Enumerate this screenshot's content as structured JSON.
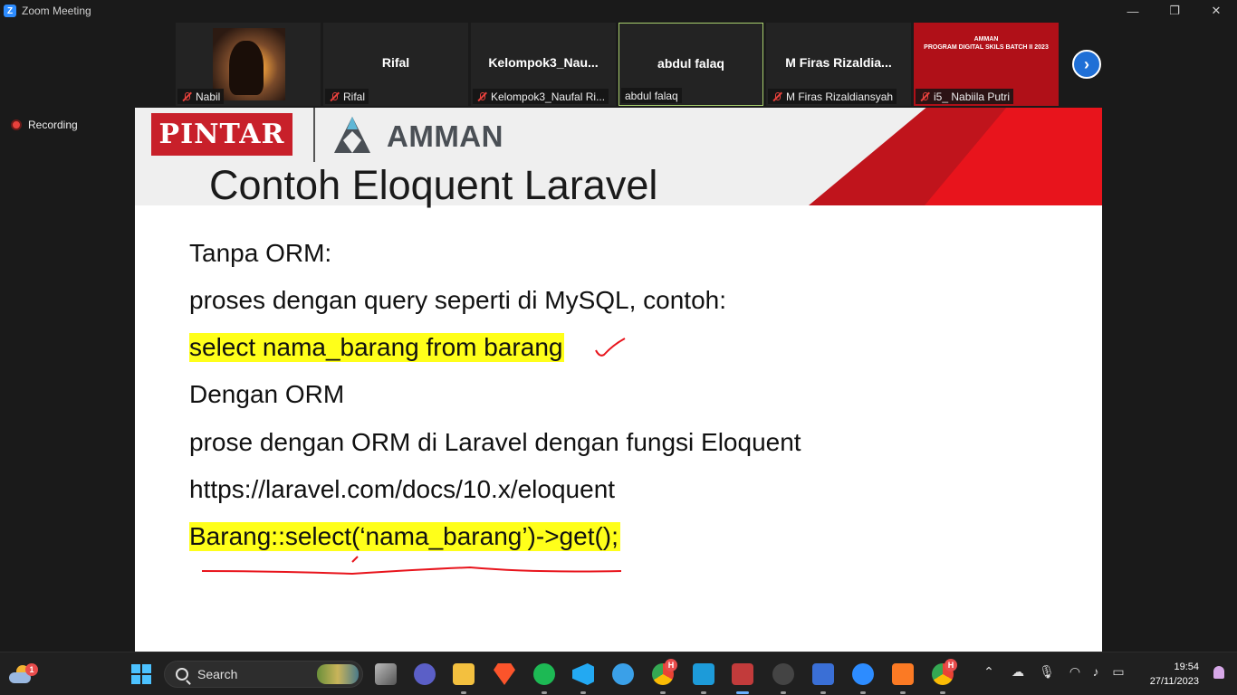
{
  "window": {
    "title": "Zoom Meeting",
    "app_letter": "Z"
  },
  "window_controls": {
    "minimize": "—",
    "restore": "❐",
    "close": "✕"
  },
  "participants": [
    {
      "display": "",
      "label": "Nabil",
      "muted": true,
      "type": "photo"
    },
    {
      "display": "Rifal",
      "label": "Rifal",
      "muted": true,
      "type": "name"
    },
    {
      "display": "Kelompok3_Nau...",
      "label": "Kelompok3_Naufal Ri...",
      "muted": true,
      "type": "name"
    },
    {
      "display": "abdul falaq",
      "label": "abdul falaq",
      "muted": false,
      "type": "name",
      "active": true
    },
    {
      "display": "M  Firas  Rizaldia...",
      "label": "M Firas Rizaldiansyah",
      "muted": true,
      "type": "name"
    },
    {
      "display": "",
      "label": "i5_ Nabiila Putri",
      "muted": true,
      "type": "banner",
      "banner_text": "PROGRAM DIGITAL SKILS BATCH II 2023",
      "banner_brand": "AMMAN"
    }
  ],
  "next_button_icon": "chevron-right-icon",
  "recording": {
    "label": "Recording"
  },
  "slide": {
    "logo_pintar": "PINTAR",
    "logo_amman": "AMMAN",
    "title": "Contoh Eloquent Laravel",
    "lines": [
      "Tanpa ORM:",
      "proses dengan query seperti di MySQL, contoh:",
      "select nama_barang from barang",
      "Dengan ORM",
      "prose dengan ORM di Laravel dengan fungsi Eloquent",
      "https://laravel.com/docs/10.x/eloquent",
      "Barang::select(‘nama_barang’)->get();"
    ],
    "highlight_color": "#ffff1a",
    "annotation_color": "#e8141c"
  },
  "taskbar": {
    "weather_badge": "1",
    "search_label": "Search",
    "chrome_badge": "H",
    "chrome2_badge": "H",
    "brave_badge": "H",
    "clock_time": "19:54",
    "clock_date": "27/11/2023"
  }
}
